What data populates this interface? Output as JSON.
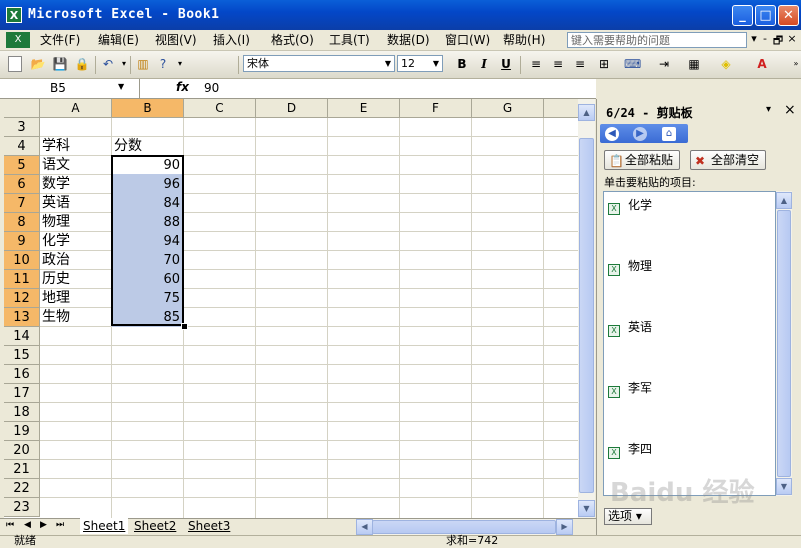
{
  "window": {
    "title": "Microsoft Excel - Book1",
    "app_icon": "X",
    "minimize": "_",
    "maximize": "□",
    "close": "✕"
  },
  "menu": {
    "items": [
      "文件(F)",
      "编辑(E)",
      "视图(V)",
      "插入(I)",
      "格式(O)",
      "工具(T)",
      "数据(D)",
      "窗口(W)",
      "帮助(H)"
    ],
    "help_placeholder": "键入需要帮助的问题",
    "mdi_min": "-",
    "mdi_restore": "🗗",
    "mdi_close": "×"
  },
  "toolbar": {
    "font_name": "宋体",
    "font_size": "12",
    "bold": "B",
    "italic": "I",
    "underline": "U"
  },
  "formula_bar": {
    "name_box": "B5",
    "fx": "fx",
    "value": "90"
  },
  "grid": {
    "columns": [
      "A",
      "B",
      "C",
      "D",
      "E",
      "F",
      "G"
    ],
    "row_numbers": [
      "3",
      "4",
      "5",
      "6",
      "7",
      "8",
      "9",
      "10",
      "11",
      "12",
      "13",
      "14",
      "15",
      "16",
      "17",
      "18",
      "19",
      "20",
      "21",
      "22",
      "23"
    ],
    "header_a": "学科",
    "header_b": "分数",
    "subjects": [
      "语文",
      "数学",
      "英语",
      "物理",
      "化学",
      "政治",
      "历史",
      "地理",
      "生物"
    ],
    "scores": [
      "90",
      "96",
      "84",
      "88",
      "94",
      "70",
      "60",
      "75",
      "85"
    ]
  },
  "sheets": {
    "tabs": [
      "Sheet1",
      "Sheet2",
      "Sheet3"
    ],
    "active": "Sheet1"
  },
  "status": {
    "ready": "就绪",
    "sum": "求和=742"
  },
  "clipboard_pane": {
    "title": "6/24 - 剪贴板",
    "paste_all": "全部粘贴",
    "clear_all": "全部清空",
    "hint": "单击要粘贴的项目:",
    "items": [
      "化学",
      "物理",
      "英语",
      "李军",
      "李四"
    ],
    "options": "选项 ▾",
    "close": "×",
    "dropdown": "▾"
  },
  "watermark": "Baidu 经验",
  "colors": {
    "title_bar": "#0347c8",
    "selection_fill": "#bccae6",
    "selected_header": "#f5b868"
  }
}
